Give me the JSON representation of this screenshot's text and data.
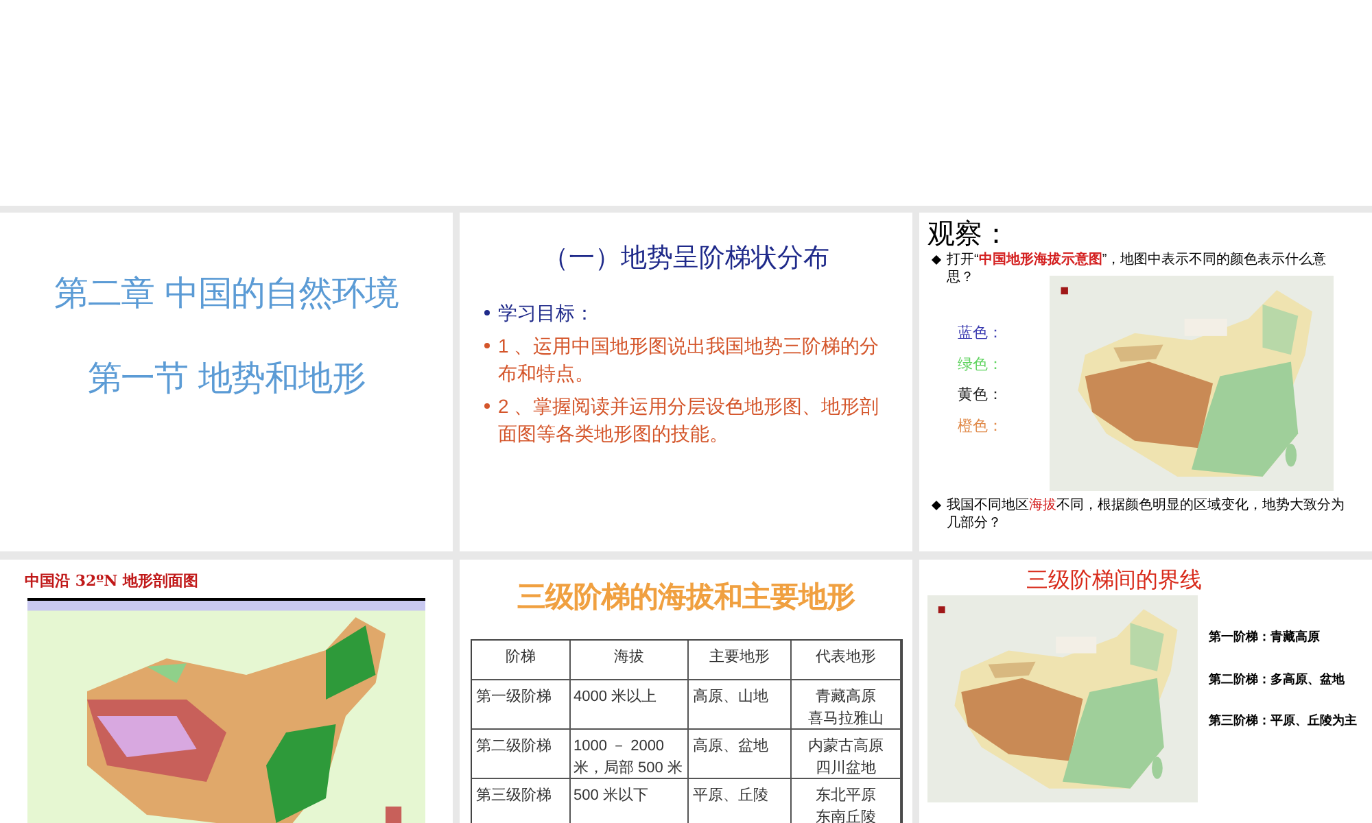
{
  "slides": [
    {
      "kind": "title",
      "lines": [
        "第二章 中国的自然环境",
        "第一节 地势和地形"
      ]
    },
    {
      "kind": "objectives",
      "title": "（一）地势呈阶梯状分布",
      "bullets": [
        {
          "text": "学习目标：",
          "color": "#1f2a8a"
        },
        {
          "text": "1 、运用中国地形图说出我国地势三阶梯的分布和特点。",
          "color": "#d4552a"
        },
        {
          "text": "2 、掌握阅读并运用分层设色地形图、地形剖面图等各类地形图的技能。",
          "color": "#d4552a"
        }
      ]
    },
    {
      "kind": "observe",
      "title": "观察：",
      "bullets": [
        "打开“**中国地形海拔示意图**”，地图中表示不同的颜色表示什么意思？",
        "我国不同地区**海拔**不同，根据颜色明显的区域变化，地势大致分为几部分？"
      ],
      "colors": [
        {
          "text": "蓝色：",
          "color": "#3b3bb0"
        },
        {
          "text": "绿色：",
          "color": "#5fd35f"
        },
        {
          "text": "黄色：",
          "color": "#222222"
        },
        {
          "text": "橙色：",
          "color": "#e08a4a"
        }
      ]
    },
    {
      "kind": "profile",
      "title": "中国沿 32ºN 地形剖面图"
    },
    {
      "kind": "table",
      "title": "三级阶梯的海拔和主要地形",
      "columns": [
        "阶梯",
        "海拔",
        "主要地形",
        "代表地形"
      ],
      "rows": [
        [
          "第一级阶梯",
          "4000 米以上",
          "高原、山地",
          [
            "青藏高原",
            "喜马拉雅山"
          ]
        ],
        [
          "第二级阶梯",
          "1000 － 2000 米，局部 500 米",
          "高原、盆地",
          [
            "内蒙古高原",
            "四川盆地"
          ]
        ],
        [
          "第三级阶梯",
          "500 米以下",
          "平原、丘陵",
          [
            "东北平原",
            "东南丘陵"
          ]
        ]
      ]
    },
    {
      "kind": "boundary",
      "title": "三级阶梯间的界线",
      "notes": [
        "第一阶梯：青藏高原",
        "第二阶梯：多高原、盆地",
        "第三阶梯：平原、丘陵为主"
      ]
    }
  ]
}
